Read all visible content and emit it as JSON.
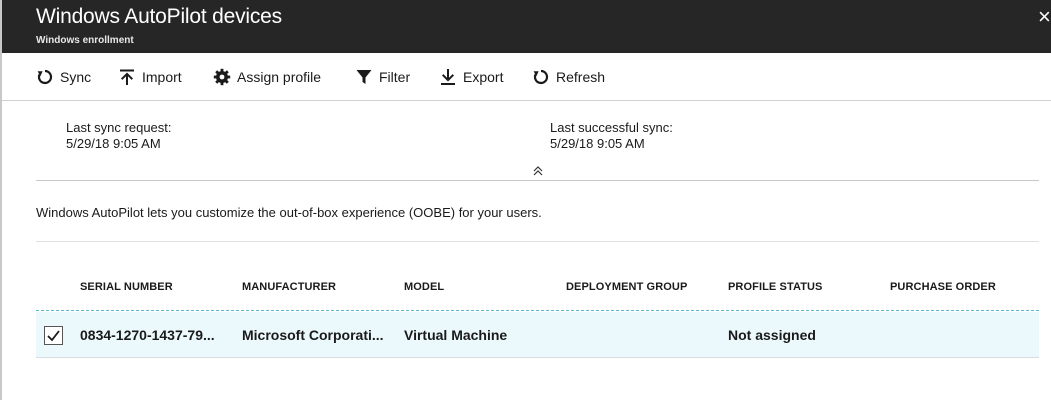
{
  "header": {
    "title": "Windows AutoPilot devices",
    "subtitle": "Windows enrollment",
    "close_glyph": "×"
  },
  "toolbar": {
    "sync": {
      "label": "Sync",
      "icon": "sync-icon"
    },
    "import": {
      "label": "Import",
      "icon": "import-icon"
    },
    "assign_profile": {
      "label": "Assign profile",
      "icon": "gear-icon"
    },
    "filter": {
      "label": "Filter",
      "icon": "filter-icon"
    },
    "export": {
      "label": "Export",
      "icon": "export-icon"
    },
    "refresh": {
      "label": "Refresh",
      "icon": "refresh-icon"
    }
  },
  "sync_info": {
    "last_request_label": "Last sync request:",
    "last_request_value": "5/29/18 9:05 AM",
    "last_success_label": "Last successful sync:",
    "last_success_value": "5/29/18 9:05 AM"
  },
  "description": "Windows AutoPilot lets you customize the out-of-box experience (OOBE) for your users.",
  "table": {
    "columns": [
      "SERIAL NUMBER",
      "MANUFACTURER",
      "MODEL",
      "DEPLOYMENT GROUP",
      "PROFILE STATUS",
      "PURCHASE ORDER"
    ],
    "rows": [
      {
        "selected": true,
        "serial_number": "0834-1270-1437-79...",
        "manufacturer": "Microsoft Corporati...",
        "model": "Virtual Machine",
        "deployment_group": "",
        "profile_status": "Not assigned",
        "purchase_order": ""
      }
    ]
  },
  "colors": {
    "header_bg": "#262626",
    "row_selected_bg": "#ecf9fc",
    "accent_dashed": "#5fb5c8"
  }
}
